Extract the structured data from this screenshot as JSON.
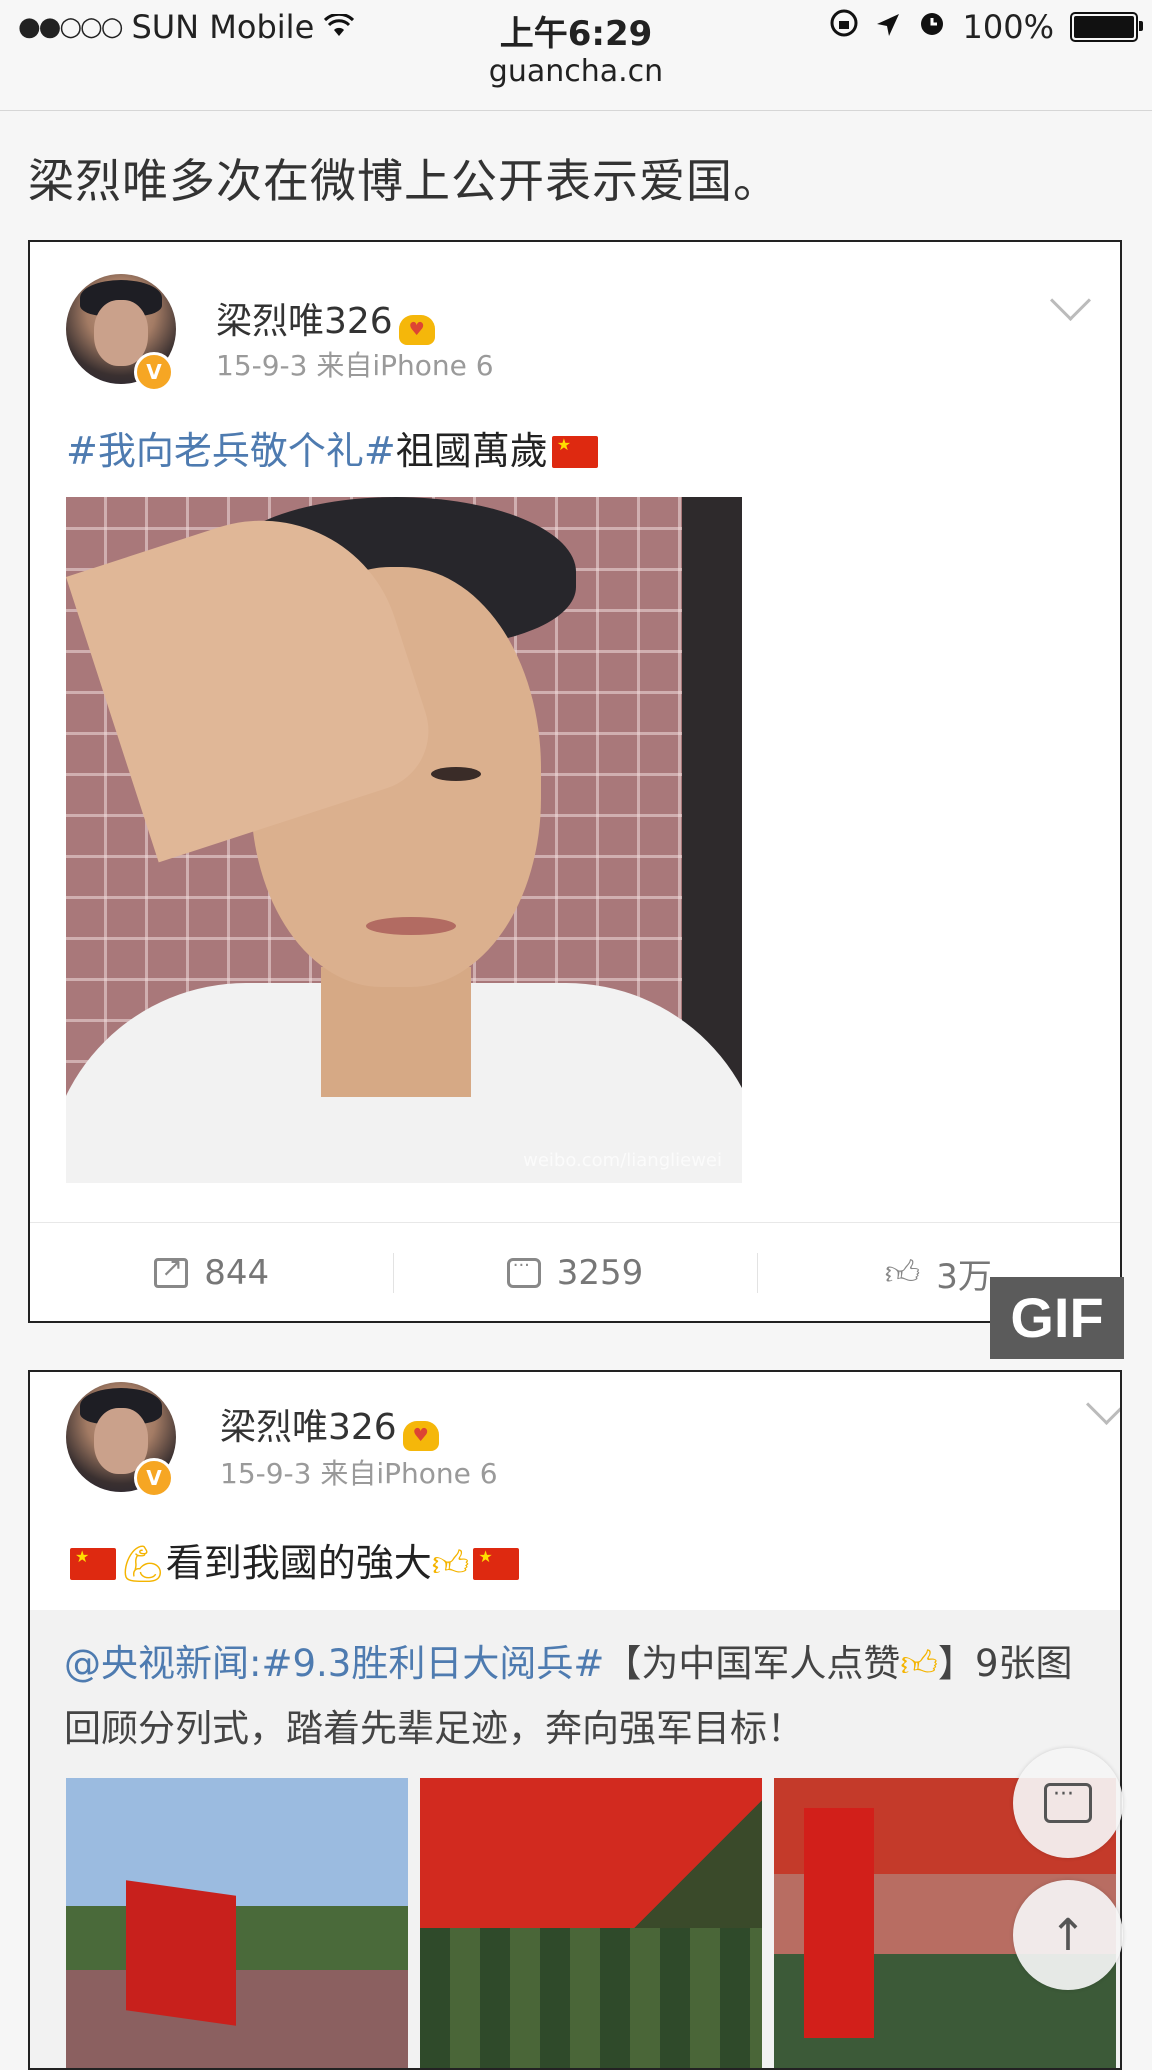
{
  "status_bar": {
    "signal": "●●○○○",
    "carrier": "SUN Mobile",
    "time": "上午6:29",
    "url": "guancha.cn",
    "battery": "100%",
    "icons": [
      "wifi-icon",
      "rotation-lock-icon",
      "location-icon",
      "alarm-icon",
      "battery-icon"
    ]
  },
  "headline": "梁烈唯多次在微博上公开表示爱国。",
  "post1": {
    "username": "梁烈唯326",
    "meta": "15-9-3  来自iPhone 6",
    "hashtag": "#我向老兵敬个礼#",
    "text": "祖國萬歲",
    "image_watermark": "weibo.com/liangliewei",
    "actions": {
      "repost": "844",
      "comment": "3259",
      "like": "3万"
    }
  },
  "gif_badge": "GIF",
  "post2": {
    "username": "梁烈唯326",
    "meta": "15-9-3  来自iPhone 6",
    "text": "看到我國的強大",
    "quote": {
      "mention": "@央视新闻:",
      "hashtag": "#9.3胜利日大阅兵#",
      "text": "【为中国军人点赞",
      "text_end": "】9张图回顾分列式，踏着先辈足迹，奔向强军目标！"
    }
  },
  "colors": {
    "link": "#4e7bb0",
    "verified": "#f6a623",
    "flag": "#de2910"
  }
}
